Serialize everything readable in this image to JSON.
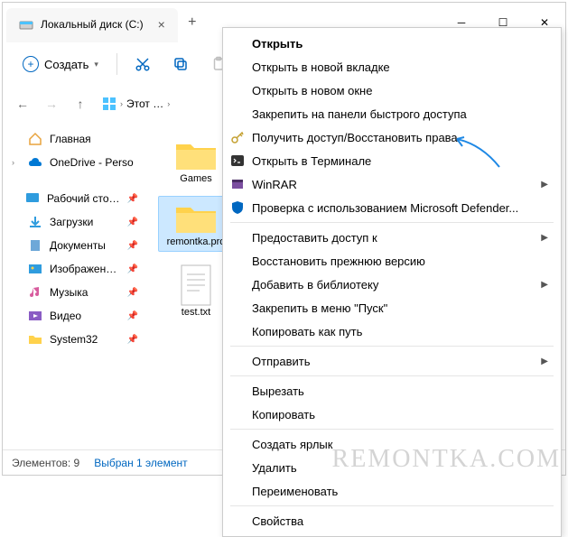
{
  "title": "Локальный диск (C:)",
  "toolbar": {
    "create": "Создать"
  },
  "breadcrumb": {
    "text": "Этот …"
  },
  "sidebar": {
    "home": "Главная",
    "onedrive": "OneDrive - Perso",
    "desktop": "Рабочий сто…",
    "downloads": "Загрузки",
    "documents": "Документы",
    "pictures": "Изображен…",
    "music": "Музыка",
    "videos": "Видео",
    "system32": "System32"
  },
  "files": {
    "games": "Games",
    "remontka": "remontka.pro",
    "test": "test.txt"
  },
  "status": {
    "count": "Элементов: 9",
    "selected": "Выбран 1 элемент"
  },
  "menu": {
    "open": "Открыть",
    "open_new_tab": "Открыть в новой вкладке",
    "open_new_window": "Открыть в новом окне",
    "pin_quick": "Закрепить на панели быстрого доступа",
    "get_access": "Получить доступ/Восстановить права",
    "open_terminal": "Открыть в Терминале",
    "winrar": "WinRAR",
    "defender": "Проверка с использованием Microsoft Defender...",
    "give_access": "Предоставить доступ к",
    "restore_prev": "Восстановить прежнюю версию",
    "add_library": "Добавить в библиотеку",
    "pin_start": "Закрепить в меню \"Пуск\"",
    "copy_path": "Копировать как путь",
    "send_to": "Отправить",
    "cut": "Вырезать",
    "copy": "Копировать",
    "shortcut": "Создать ярлык",
    "delete": "Удалить",
    "rename": "Переименовать",
    "properties": "Свойства"
  },
  "watermark": "REMONTKA.COM"
}
